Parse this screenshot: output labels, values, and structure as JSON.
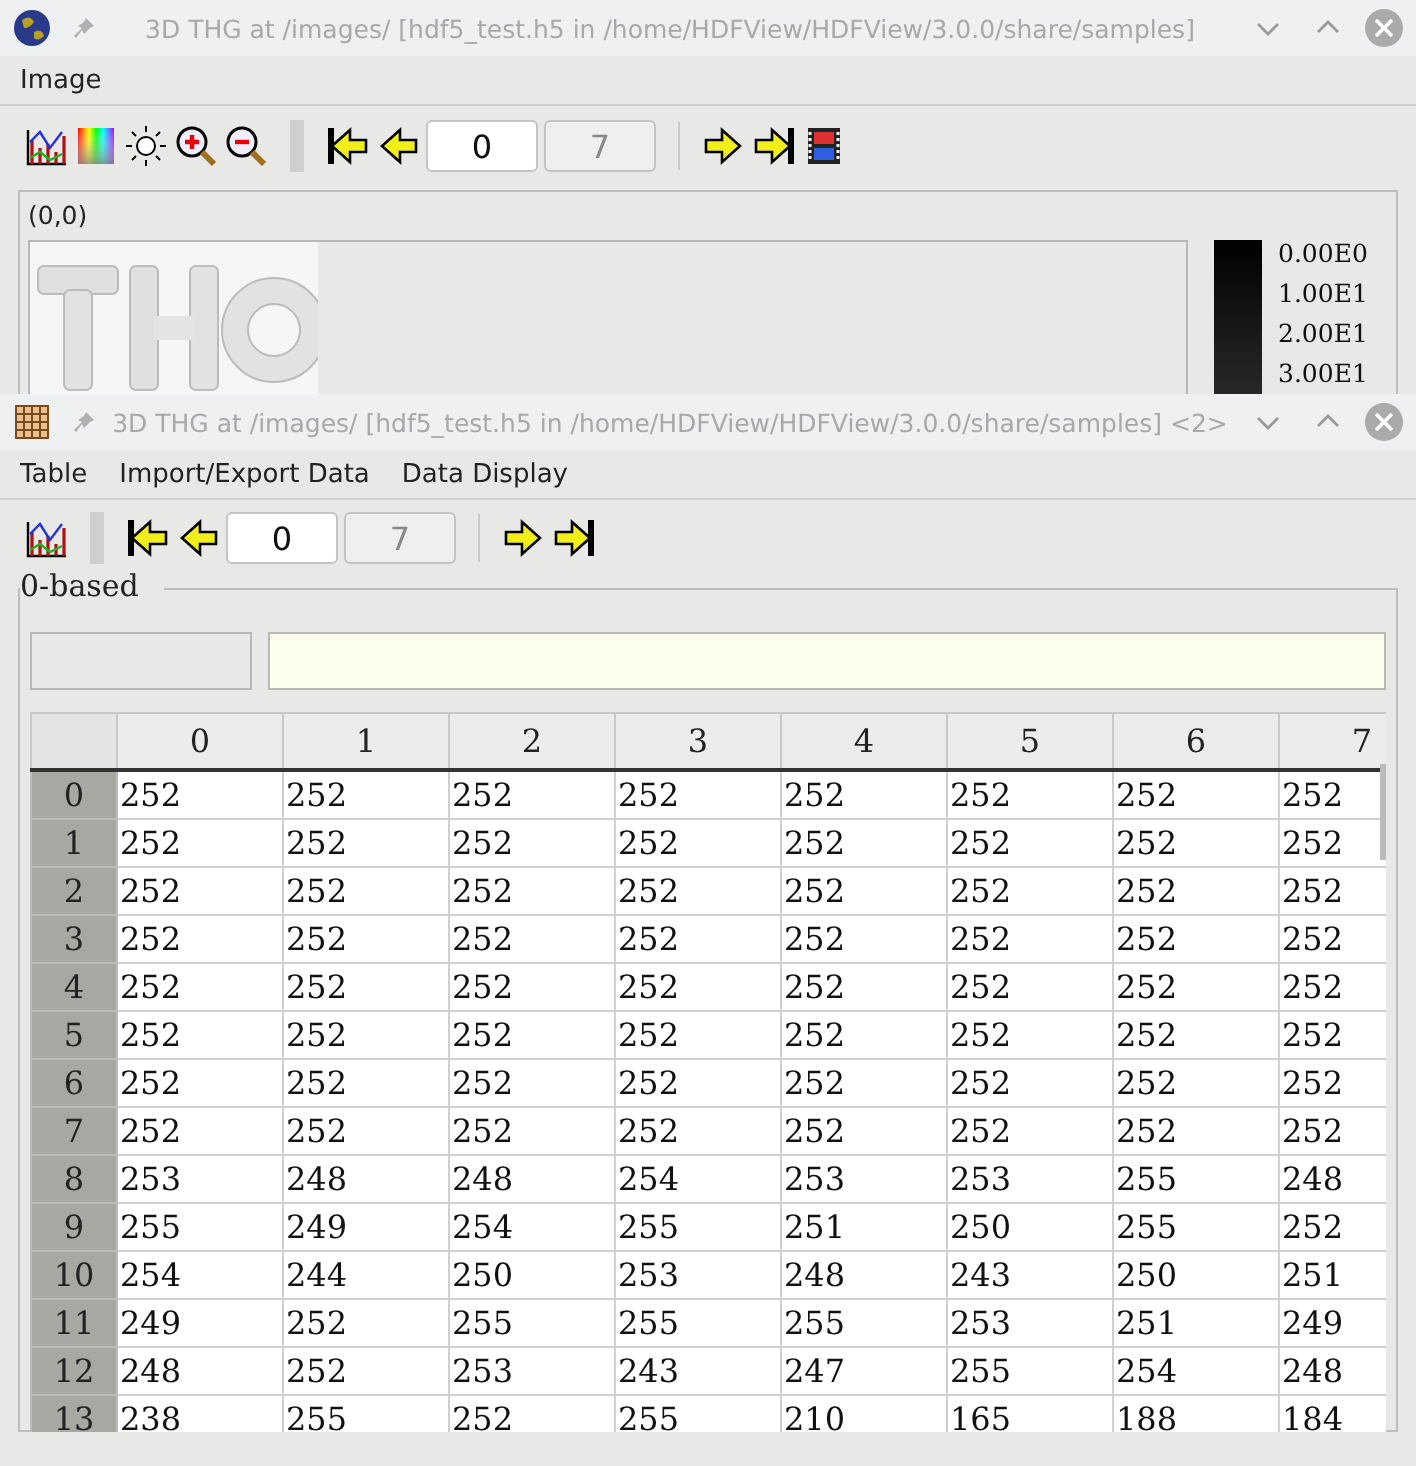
{
  "image_window": {
    "title": "3D THG at /images/ [hdf5_test.h5 in /home/HDFView/HDFView/3.0.0/share/samples]",
    "menu": [
      "Image"
    ],
    "frame_field": {
      "value": "0"
    },
    "frame_max": {
      "value": "7",
      "disabled": true
    },
    "coordinates": "(0,0)",
    "colorbar_labels": [
      "0.00E0",
      "1.00E1",
      "2.00E1",
      "3.00E1"
    ]
  },
  "table_window": {
    "title": "3D THG at /images/ [hdf5_test.h5 in /home/HDFView/HDFView/3.0.0/share/samples] <2>",
    "menu": [
      "Table",
      "Import/Export Data",
      "Data Display"
    ],
    "frame_field": {
      "value": "0"
    },
    "frame_max": {
      "value": "7",
      "disabled": true
    },
    "group_label": "0-based",
    "table": {
      "columns": [
        "0",
        "1",
        "2",
        "3",
        "4",
        "5",
        "6",
        "7"
      ],
      "rows": [
        {
          "index": "0",
          "cells": [
            "252",
            "252",
            "252",
            "252",
            "252",
            "252",
            "252",
            "252"
          ]
        },
        {
          "index": "1",
          "cells": [
            "252",
            "252",
            "252",
            "252",
            "252",
            "252",
            "252",
            "252"
          ]
        },
        {
          "index": "2",
          "cells": [
            "252",
            "252",
            "252",
            "252",
            "252",
            "252",
            "252",
            "252"
          ]
        },
        {
          "index": "3",
          "cells": [
            "252",
            "252",
            "252",
            "252",
            "252",
            "252",
            "252",
            "252"
          ]
        },
        {
          "index": "4",
          "cells": [
            "252",
            "252",
            "252",
            "252",
            "252",
            "252",
            "252",
            "252"
          ]
        },
        {
          "index": "5",
          "cells": [
            "252",
            "252",
            "252",
            "252",
            "252",
            "252",
            "252",
            "252"
          ]
        },
        {
          "index": "6",
          "cells": [
            "252",
            "252",
            "252",
            "252",
            "252",
            "252",
            "252",
            "252"
          ]
        },
        {
          "index": "7",
          "cells": [
            "252",
            "252",
            "252",
            "252",
            "252",
            "252",
            "252",
            "252"
          ]
        },
        {
          "index": "8",
          "cells": [
            "253",
            "248",
            "248",
            "254",
            "253",
            "253",
            "255",
            "248"
          ]
        },
        {
          "index": "9",
          "cells": [
            "255",
            "249",
            "254",
            "255",
            "251",
            "250",
            "255",
            "252"
          ]
        },
        {
          "index": "10",
          "cells": [
            "254",
            "244",
            "250",
            "253",
            "248",
            "243",
            "250",
            "251"
          ]
        },
        {
          "index": "11",
          "cells": [
            "249",
            "252",
            "255",
            "255",
            "255",
            "253",
            "251",
            "249"
          ]
        },
        {
          "index": "12",
          "cells": [
            "248",
            "252",
            "253",
            "243",
            "247",
            "255",
            "254",
            "248"
          ]
        },
        {
          "index": "13",
          "cells": [
            "238",
            "255",
            "252",
            "255",
            "210",
            "165",
            "188",
            "184"
          ]
        }
      ]
    }
  }
}
